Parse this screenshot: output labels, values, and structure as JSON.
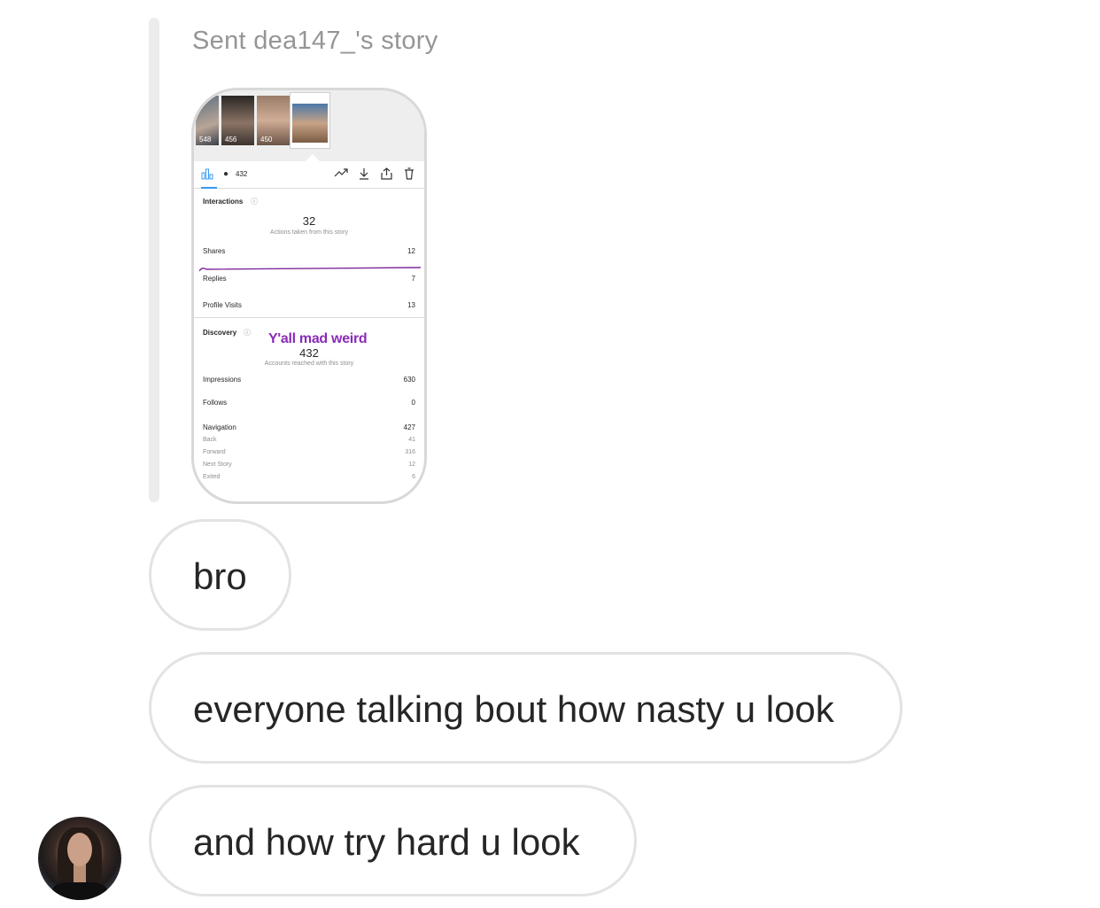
{
  "thread": {
    "sent_label": "Sent dea147_'s story"
  },
  "story_preview": {
    "thumb_views": [
      "548",
      "456",
      "450"
    ],
    "views": "432",
    "interactions": {
      "title": "Interactions",
      "total": "32",
      "caption": "Actions taken from this story",
      "rows": [
        {
          "label": "Shares",
          "value": "12"
        },
        {
          "label": "Replies",
          "value": "7"
        },
        {
          "label": "Profile Visits",
          "value": "13"
        }
      ]
    },
    "discovery": {
      "title": "Discovery",
      "total": "432",
      "caption": "Accounts reached with this story",
      "rows": [
        {
          "label": "Impressions",
          "value": "630"
        },
        {
          "label": "Follows",
          "value": "0"
        },
        {
          "label": "Navigation",
          "value": "427"
        }
      ],
      "subrows": [
        {
          "label": "Back",
          "value": "41"
        },
        {
          "label": "Forward",
          "value": "316"
        },
        {
          "label": "Next Story",
          "value": "12"
        },
        {
          "label": "Exited",
          "value": "6"
        }
      ]
    },
    "sticker_text": "Y'all mad weird",
    "sticker_color": "#8a2bb8"
  },
  "messages": [
    {
      "text": "bro"
    },
    {
      "text": "everyone talking bout how nasty u look"
    },
    {
      "text": "and how try hard u look"
    }
  ],
  "colors": {
    "bubble_border": "#e3e3e3",
    "accent_blue": "#3897f0",
    "muted_text": "#959595"
  }
}
